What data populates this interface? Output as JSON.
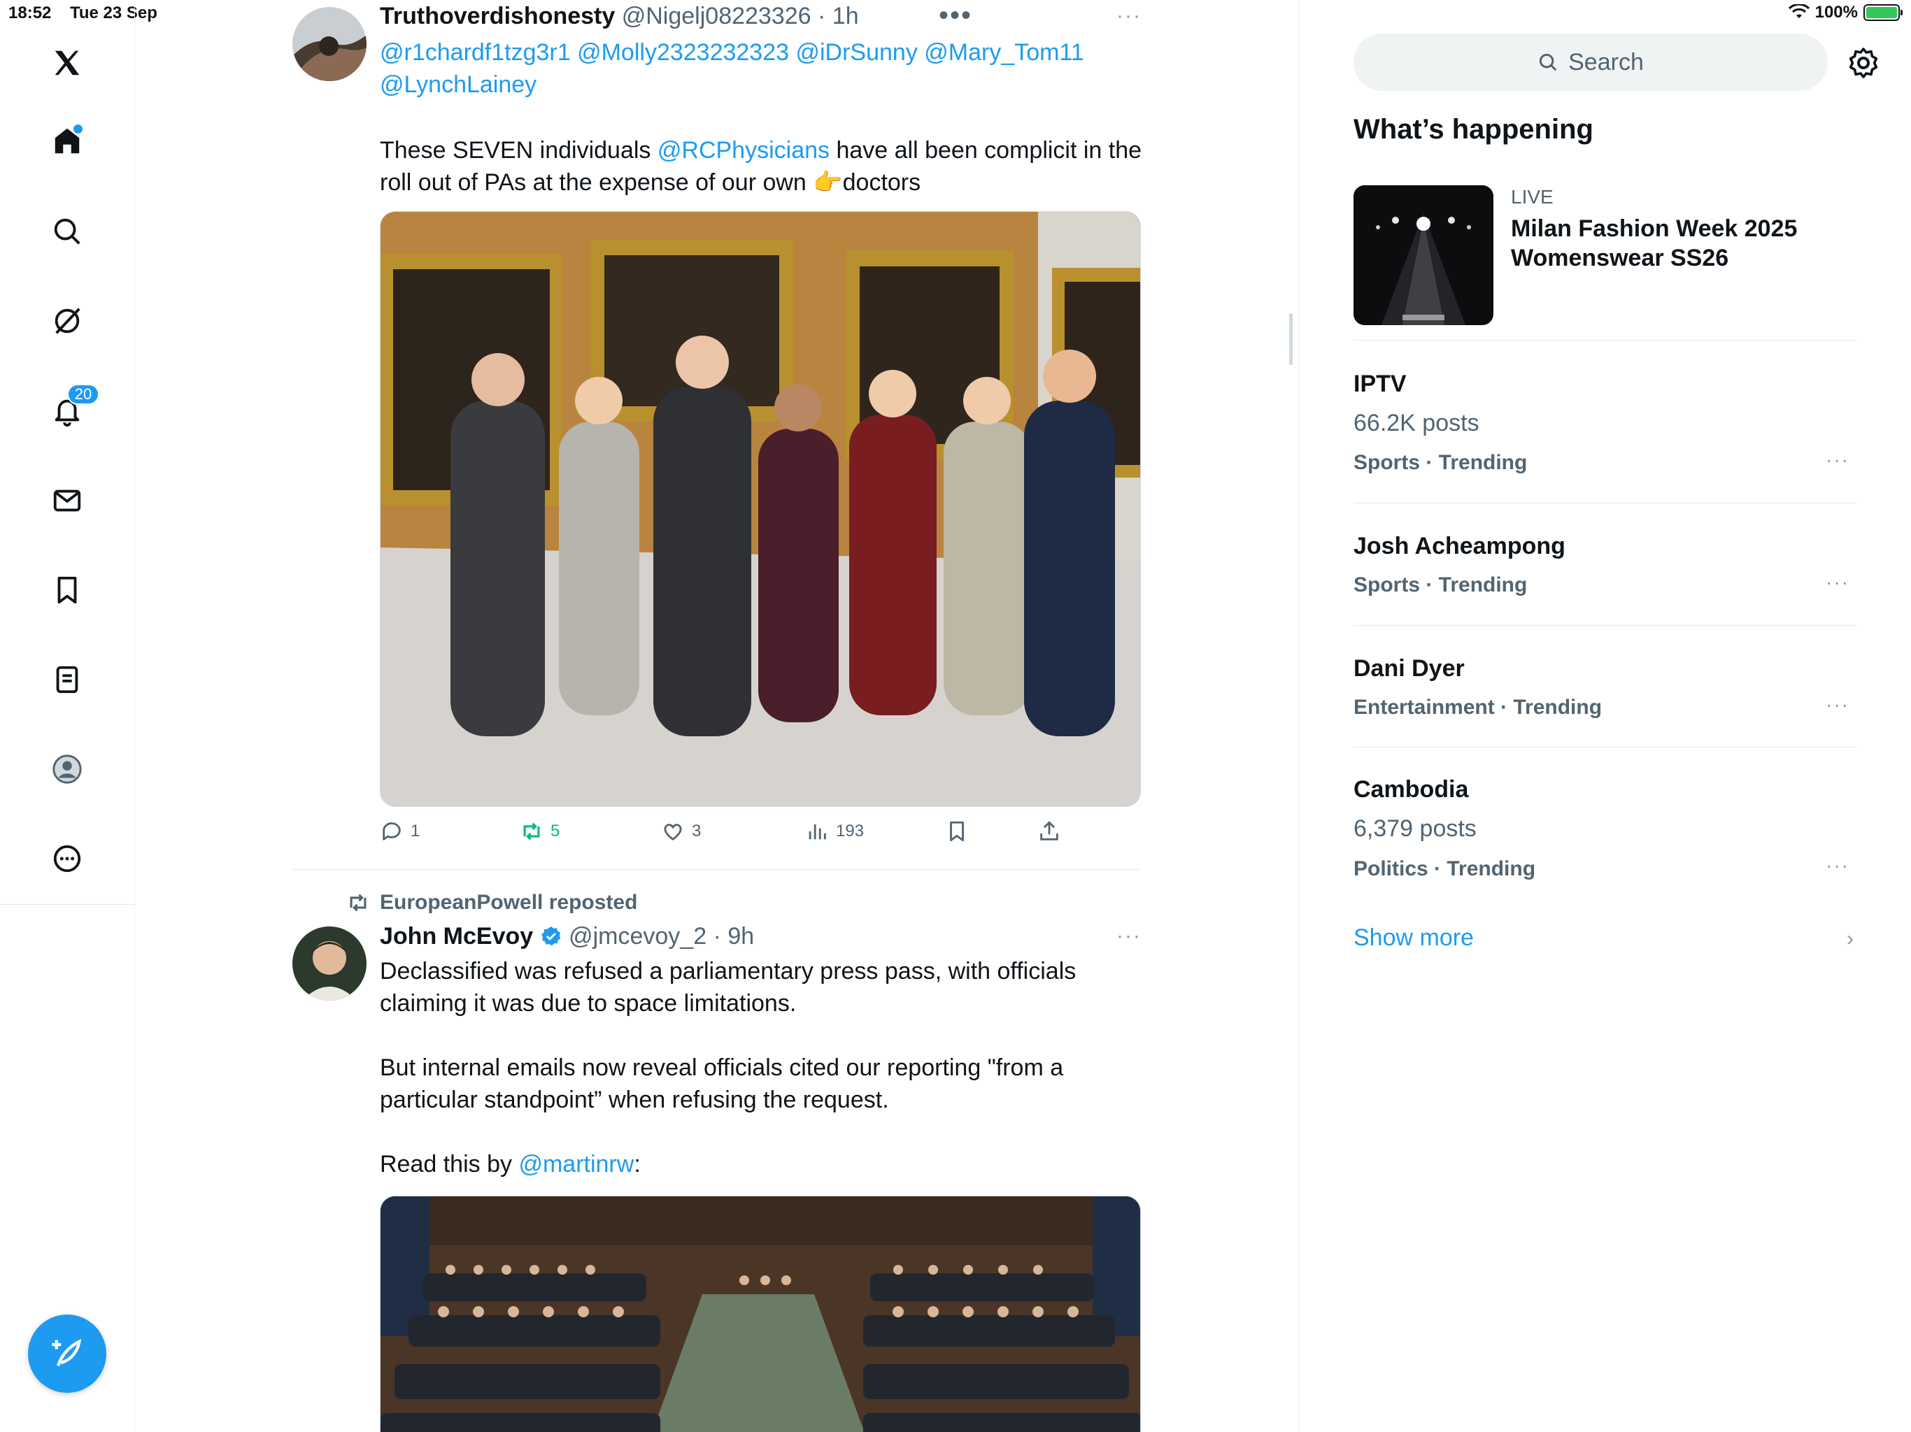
{
  "status_bar": {
    "time": "18:52",
    "date": "Tue 23 Sep",
    "battery": "100%"
  },
  "nav": {
    "notifications_count": "20",
    "items": [
      "home",
      "explore",
      "grok",
      "notifications",
      "messages",
      "bookmarks",
      "lists",
      "profile",
      "more"
    ]
  },
  "tweet1": {
    "name": "Truthoverdishonesty",
    "handle": "@Nigelj08223326",
    "time": "· 1h",
    "mentions_line1": "@r1chardf1tzg3r1 @Molly2323232323 @iDrSunny @Mary_Tom11",
    "mentions_line2": "@LynchLainey",
    "text_before": "These SEVEN individuals ",
    "text_link": "@RCPhysicians",
    "text_mid": " have all been complicit in the",
    "text_line2": "roll out of PAs at the expense of our own 👉doctors",
    "replies": "1",
    "reposts": "5",
    "likes": "3",
    "views": "193"
  },
  "tweet2": {
    "repost_label": "EuropeanPowell reposted",
    "name": "John McEvoy",
    "handle": "@jmcevoy_2",
    "time": "· 9h",
    "line1": "Declassified was refused a parliamentary press pass, with officials",
    "line2": "claiming it was due to space limitations.",
    "line3": "But internal emails now reveal officials cited our reporting \"from a",
    "line4": "particular standpoint” when refusing the request.",
    "line5_text": "Read this by ",
    "line5_link": "@martinrw",
    "line5_end": ":"
  },
  "right": {
    "search_placeholder": "Search",
    "heading": "What’s happening",
    "live": {
      "label": "LIVE",
      "title": "Milan Fashion Week 2025 Womenswear SS26"
    },
    "trends": [
      {
        "title": "IPTV",
        "posts": "66.2K posts",
        "meta": "Sports · Trending"
      },
      {
        "title": "Josh Acheampong",
        "posts": "",
        "meta": "Sports · Trending"
      },
      {
        "title": "Dani Dyer",
        "posts": "",
        "meta": "Entertainment · Trending"
      },
      {
        "title": "Cambodia",
        "posts": "6,379 posts",
        "meta": "Politics · Trending"
      }
    ],
    "show_more": "Show more"
  },
  "colors": {
    "accent": "#1d9bf0",
    "repost_green": "#00ba7c",
    "muted": "#536471"
  }
}
